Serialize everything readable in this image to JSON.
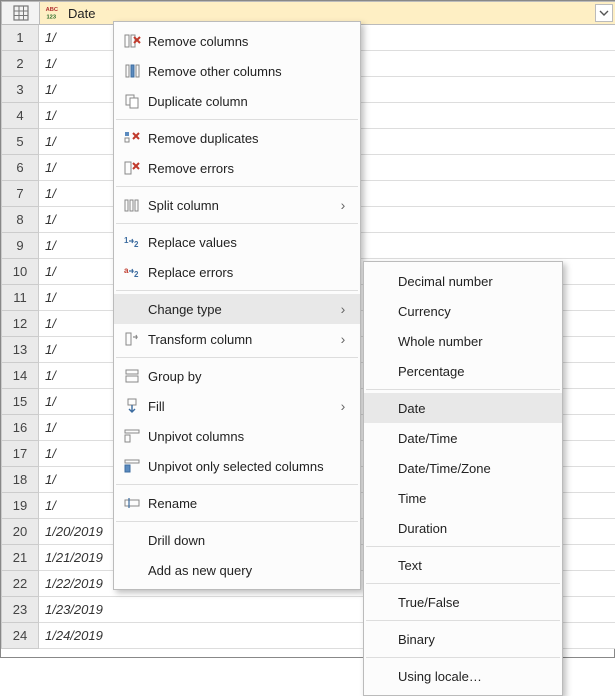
{
  "column": {
    "header_label": "Date",
    "type_icon_top": "ABC",
    "type_icon_bottom": "123"
  },
  "rows": [
    {
      "num": "1",
      "value": "1/"
    },
    {
      "num": "2",
      "value": "1/"
    },
    {
      "num": "3",
      "value": "1/"
    },
    {
      "num": "4",
      "value": "1/"
    },
    {
      "num": "5",
      "value": "1/"
    },
    {
      "num": "6",
      "value": "1/"
    },
    {
      "num": "7",
      "value": "1/"
    },
    {
      "num": "8",
      "value": "1/"
    },
    {
      "num": "9",
      "value": "1/"
    },
    {
      "num": "10",
      "value": "1/"
    },
    {
      "num": "11",
      "value": "1/"
    },
    {
      "num": "12",
      "value": "1/"
    },
    {
      "num": "13",
      "value": "1/"
    },
    {
      "num": "14",
      "value": "1/"
    },
    {
      "num": "15",
      "value": "1/"
    },
    {
      "num": "16",
      "value": "1/"
    },
    {
      "num": "17",
      "value": "1/"
    },
    {
      "num": "18",
      "value": "1/"
    },
    {
      "num": "19",
      "value": "1/"
    },
    {
      "num": "20",
      "value": "1/20/2019"
    },
    {
      "num": "21",
      "value": "1/21/2019"
    },
    {
      "num": "22",
      "value": "1/22/2019"
    },
    {
      "num": "23",
      "value": "1/23/2019"
    },
    {
      "num": "24",
      "value": "1/24/2019"
    }
  ],
  "menu": {
    "remove_columns": "Remove columns",
    "remove_other_columns": "Remove other columns",
    "duplicate_column": "Duplicate column",
    "remove_duplicates": "Remove duplicates",
    "remove_errors": "Remove errors",
    "split_column": "Split column",
    "replace_values": "Replace values",
    "replace_errors": "Replace errors",
    "change_type": "Change type",
    "transform_column": "Transform column",
    "group_by": "Group by",
    "fill": "Fill",
    "unpivot_columns": "Unpivot columns",
    "unpivot_only_selected": "Unpivot only selected columns",
    "rename": "Rename",
    "drill_down": "Drill down",
    "add_as_new_query": "Add as new query"
  },
  "submenu": {
    "decimal_number": "Decimal number",
    "currency": "Currency",
    "whole_number": "Whole number",
    "percentage": "Percentage",
    "date": "Date",
    "date_time": "Date/Time",
    "date_time_zone": "Date/Time/Zone",
    "time": "Time",
    "duration": "Duration",
    "text": "Text",
    "true_false": "True/False",
    "binary": "Binary",
    "using_locale": "Using locale…"
  }
}
